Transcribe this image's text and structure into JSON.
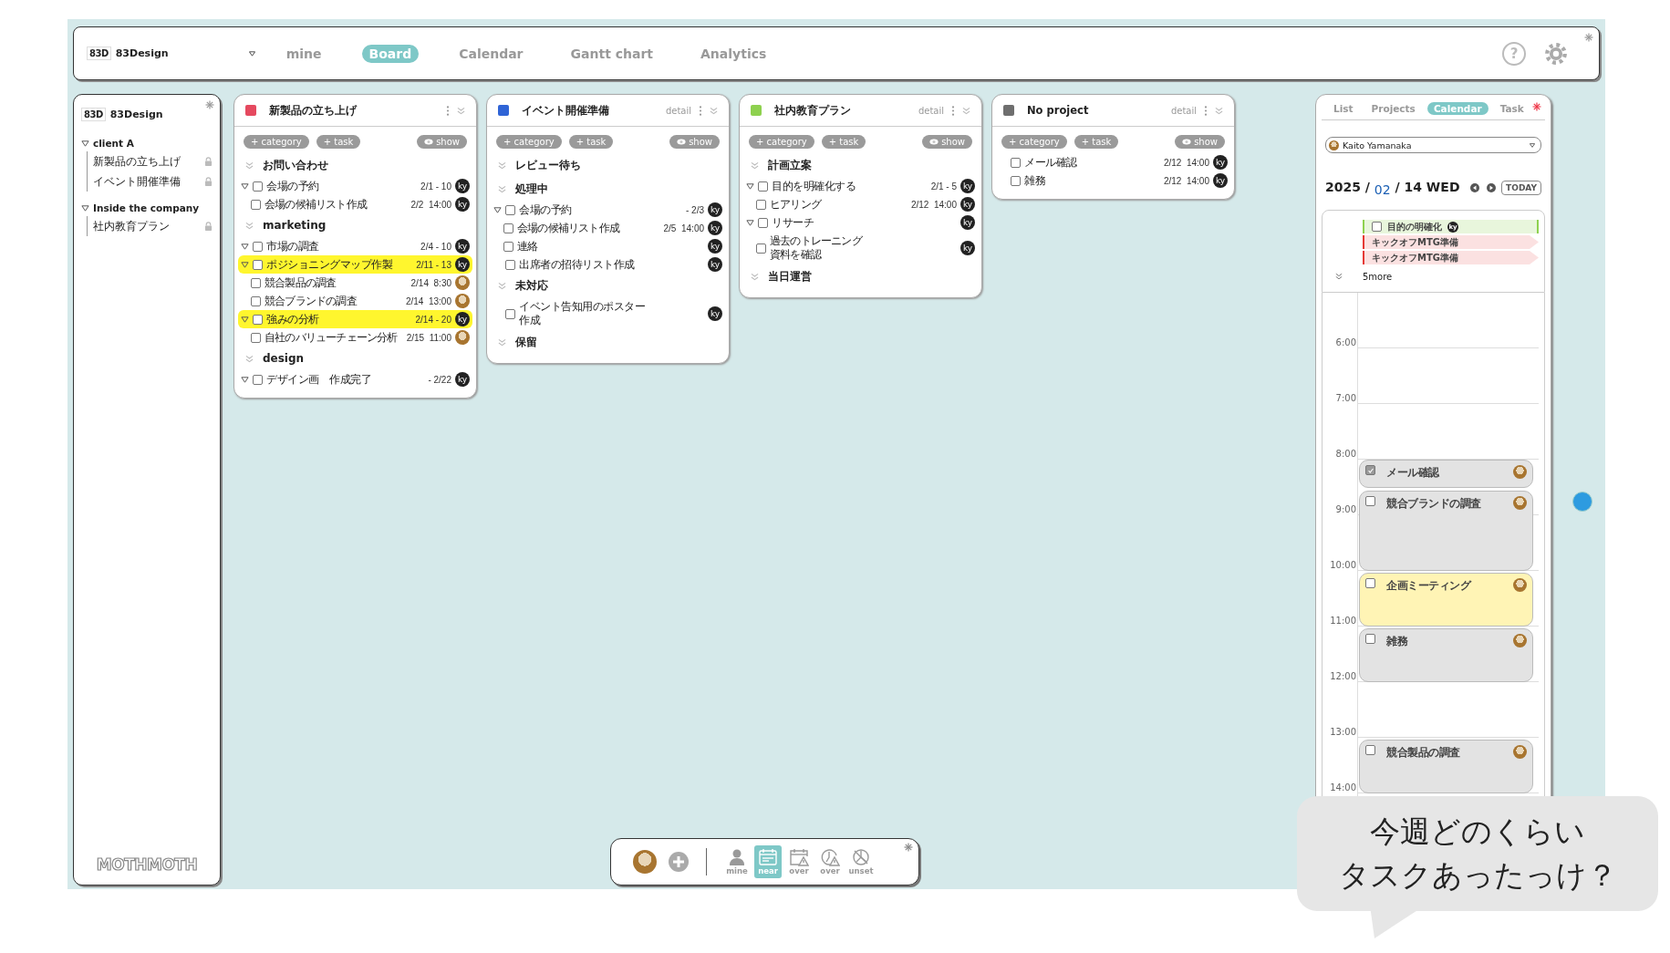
{
  "topbar": {
    "logo": "83D",
    "workspace": "83Design",
    "tabs": [
      {
        "label": "mine",
        "selected": false
      },
      {
        "label": "Board",
        "selected": true
      },
      {
        "label": "Calendar",
        "selected": false
      },
      {
        "label": "Gantt chart",
        "selected": false
      },
      {
        "label": "Analytics",
        "selected": false
      }
    ],
    "help": "?"
  },
  "sidebar": {
    "logo": "83D",
    "workspace": "83Design",
    "groups": [
      {
        "name": "client A",
        "expanded": true,
        "projects": [
          {
            "name": "新製品の立ち上げ",
            "locked": true
          },
          {
            "name": "イベント開催準備",
            "locked": true
          }
        ]
      },
      {
        "name": "Inside the company",
        "expanded": true,
        "projects": [
          {
            "name": "社内教育プラン",
            "locked": true
          }
        ]
      }
    ],
    "footer_logo": "MOTHMOTH"
  },
  "columns": [
    {
      "title": "新製品の立ち上げ",
      "color": "#e5495f",
      "buttons": [
        "+ category",
        "+ task"
      ],
      "show": "show",
      "categories": [
        {
          "name": "お問い合わせ",
          "tasks": [
            {
              "title": "会場の予約",
              "date": "2/1 - 10",
              "assignee": "ky",
              "checked": false,
              "highlighted": false,
              "expanded": true,
              "children": [
                {
                  "title": "会場の候補リスト作成",
                  "date": "2/2  14:00",
                  "assignee": "ky",
                  "checked": false,
                  "highlighted": false
                }
              ]
            }
          ]
        },
        {
          "name": "marketing",
          "tasks": [
            {
              "title": "市場の調査",
              "date": "2/4 - 10",
              "assignee": "ky",
              "checked": false,
              "highlighted": false,
              "expanded": true
            },
            {
              "title": "ポジショニングマップ作製",
              "date": "2/11 - 13",
              "assignee": "ky",
              "checked": false,
              "highlighted": true,
              "expanded": true,
              "children": [
                {
                  "title": "競合製品の調査",
                  "date": "2/14  8:30",
                  "assignee_photo": true,
                  "checked": false,
                  "highlighted": false
                },
                {
                  "title": "競合ブランドの調査",
                  "date": "2/14  13:00",
                  "assignee_photo": true,
                  "checked": false,
                  "highlighted": false
                }
              ]
            },
            {
              "title": "強みの分析",
              "date": "2/14 - 20",
              "assignee": "ky",
              "checked": false,
              "highlighted": true,
              "expanded": true,
              "children": [
                {
                  "title": "自社のバリューチェーン分析",
                  "date": "2/15  11:00",
                  "assignee_photo": true,
                  "checked": false,
                  "highlighted": false
                }
              ]
            }
          ]
        },
        {
          "name": "design",
          "tasks": [
            {
              "title": "デザイン画　作成完了",
              "date": "- 2/22",
              "assignee": "ky",
              "checked": false,
              "highlighted": false,
              "expanded": true
            }
          ]
        }
      ]
    },
    {
      "title": "イベント開催準備",
      "color": "#2f64d6",
      "detail": "detail",
      "buttons": [
        "+ category",
        "+ task"
      ],
      "show": "show",
      "categories": [
        {
          "name": "レビュー待ち"
        },
        {
          "name": "処理中",
          "tasks": [
            {
              "title": "会場の予約",
              "date": "- 2/3",
              "assignee": "ky",
              "checked": false,
              "highlighted": false,
              "expanded": true,
              "children": [
                {
                  "title": "会場の候補リスト作成",
                  "date": "2/5  14:00",
                  "assignee": "ky",
                  "checked": false,
                  "highlighted": false
                },
                {
                  "title": "連絡",
                  "assignee": "ky",
                  "checked": false,
                  "highlighted": false
                }
              ]
            },
            {
              "title": "出席者の招待リスト作成",
              "assignee": "ky",
              "checked": false,
              "highlighted": false
            }
          ]
        },
        {
          "name": "未対応",
          "tasks": [
            {
              "title_lines": [
                "イベント告知用のポスター",
                "作成"
              ],
              "assignee": "ky",
              "checked": false,
              "highlighted": false
            }
          ]
        },
        {
          "name": "保留"
        }
      ]
    },
    {
      "title": "社内教育プラン",
      "color": "#8ed14f",
      "detail": "detail",
      "buttons": [
        "+ category",
        "+ task"
      ],
      "show": "show",
      "categories": [
        {
          "name": "計画立案",
          "tasks": [
            {
              "title": "目的を明確化する",
              "date": "2/1 - 5",
              "assignee": "ky",
              "checked": false,
              "highlighted": false,
              "expanded": true,
              "children": [
                {
                  "title": "ヒアリング",
                  "date": "2/12  14:00",
                  "assignee": "ky",
                  "checked": false,
                  "highlighted": false
                }
              ]
            },
            {
              "title": "リサーチ",
              "assignee": "ky",
              "checked": false,
              "highlighted": false,
              "expanded": true,
              "children": [
                {
                  "title_lines": [
                    "過去のトレーニング",
                    "資料を確認"
                  ],
                  "assignee": "ky",
                  "checked": false,
                  "highlighted": false
                }
              ]
            }
          ]
        },
        {
          "name": "当日運営"
        }
      ]
    },
    {
      "title": "No project",
      "color": "#6e6e6e",
      "detail": "detail",
      "buttons": [
        "+ category",
        "+ task"
      ],
      "show": "show",
      "categories": [
        {
          "tasks": [
            {
              "title": "メール確認",
              "date": "2/12  14:00",
              "assignee": "ky",
              "checked": false,
              "highlighted": false
            },
            {
              "title": "雑務",
              "date": "2/12  14:00",
              "assignee": "ky",
              "checked": false,
              "highlighted": false
            }
          ]
        }
      ]
    }
  ],
  "calendar_panel": {
    "tabs": [
      {
        "label": "List",
        "selected": false
      },
      {
        "label": "Projects",
        "selected": false
      },
      {
        "label": "Calendar",
        "selected": true
      },
      {
        "label": "Task",
        "selected": false
      }
    ],
    "user": "Kaito Yamanaka",
    "date": "2025 / $_{02}$ / 14 WED",
    "today": "TODAY",
    "all_day": [
      {
        "kind": "task",
        "title": "目的の明確化",
        "color": "#8ed14f",
        "checked": false,
        "assignee": "ky"
      },
      {
        "kind": "event",
        "title": "キックオフMTG準備",
        "color": "#e53935"
      },
      {
        "kind": "event",
        "title": "キックオフMTG準備",
        "color": "#e53935"
      }
    ],
    "more": "5more",
    "hours": [
      "6:00",
      "7:00",
      "8:00",
      "9:00",
      "10:00",
      "11:00",
      "12:00",
      "13:00",
      "14:00"
    ],
    "events": [
      {
        "title": "メール確認",
        "checked": true,
        "color": "#e3e3e3"
      },
      {
        "title": "競合ブランドの調査",
        "checked": false,
        "color": "#e3e3e3"
      },
      {
        "title": "企画ミーティング",
        "checked": false,
        "color": "#fff4b5"
      },
      {
        "title": "雑務",
        "checked": false,
        "color": "#e3e3e3"
      },
      {
        "title": "競合製品の調査",
        "checked": false,
        "color": "#e3e3e3"
      }
    ]
  },
  "toolbar": {
    "filters": [
      {
        "label": "mine",
        "kind": "person",
        "selected": false
      },
      {
        "label": "near",
        "kind": "calendar",
        "selected": true
      },
      {
        "label": "over",
        "kind": "calendar-warning",
        "selected": false
      },
      {
        "label": "over",
        "kind": "clock-warning",
        "selected": false
      },
      {
        "label": "unset",
        "kind": "clock-unset",
        "selected": false
      }
    ]
  },
  "speech_bubble": {
    "lines": [
      "今週どのくらい",
      "タスクあったっけ？"
    ]
  }
}
